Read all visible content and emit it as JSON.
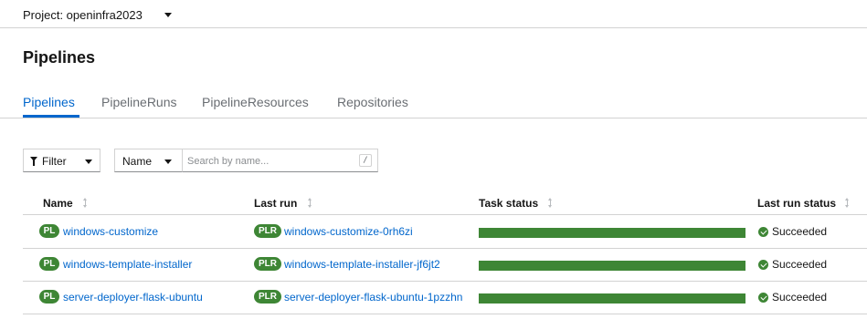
{
  "project": {
    "label": "Project: openinfra2023"
  },
  "page": {
    "title": "Pipelines"
  },
  "tabs": [
    {
      "label": "Pipelines",
      "active": true
    },
    {
      "label": "PipelineRuns",
      "active": false
    },
    {
      "label": "PipelineResources",
      "active": false
    },
    {
      "label": "Repositories",
      "active": false
    }
  ],
  "toolbar": {
    "filter_label": "Filter",
    "attribute_label": "Name",
    "search_placeholder": "Search by name...",
    "search_shortcut": "/"
  },
  "table": {
    "columns": [
      "Name",
      "Last run",
      "Task status",
      "Last run status"
    ],
    "rows": [
      {
        "badge": "PL",
        "name": "windows-customize",
        "run_badge": "PLR",
        "last_run": "windows-customize-0rh6zi",
        "task_status_complete": 1.0,
        "status": "Succeeded"
      },
      {
        "badge": "PL",
        "name": "windows-template-installer",
        "run_badge": "PLR",
        "last_run": "windows-template-installer-jf6jt2",
        "task_status_complete": 1.0,
        "status": "Succeeded"
      },
      {
        "badge": "PL",
        "name": "server-deployer-flask-ubuntu",
        "run_badge": "PLR",
        "last_run": "server-deployer-flask-ubuntu-1pzzhn",
        "task_status_complete": 1.0,
        "status": "Succeeded"
      }
    ]
  },
  "colors": {
    "accent": "#0066cc",
    "success": "#3e8635",
    "border": "#d2d2d2"
  }
}
